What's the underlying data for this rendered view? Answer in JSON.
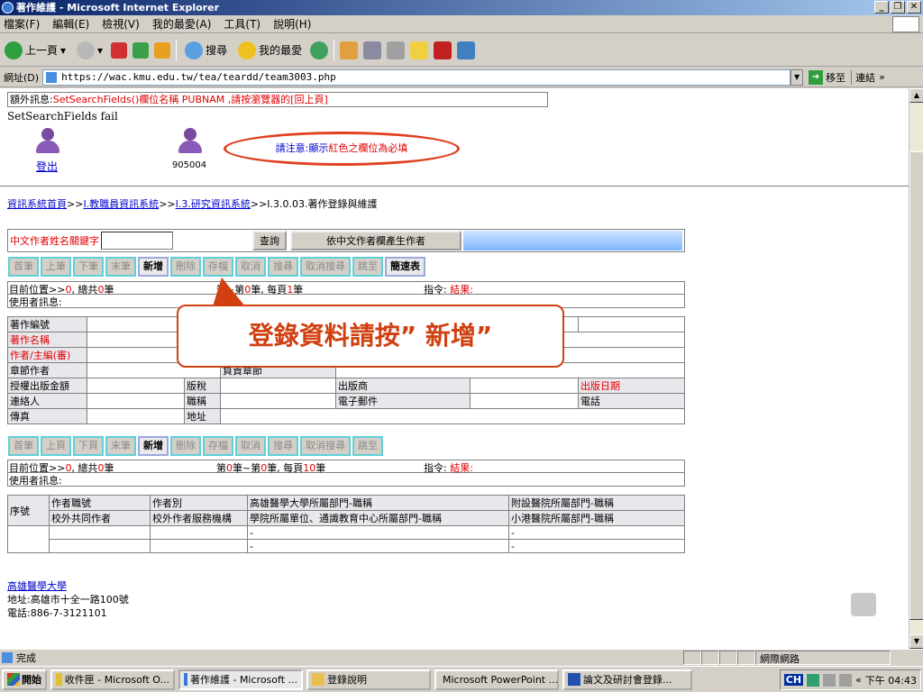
{
  "window": {
    "title": "著作維護 - Microsoft Internet Explorer"
  },
  "menu": [
    "檔案(F)",
    "編輯(E)",
    "檢視(V)",
    "我的最愛(A)",
    "工具(T)",
    "說明(H)"
  ],
  "toolbar": {
    "back": "上一頁",
    "search": "搜尋",
    "favorites": "我的最愛"
  },
  "address": {
    "label": "網址(D)",
    "url": "https://wac.kmu.edu.tw/tea/teardd/team3003.php",
    "go": "移至",
    "links": "連結"
  },
  "page": {
    "message_prefix": "額外訊息:",
    "message": "SetSearchFields()欄位名稱 PUBNAM ,請按瀏覽器的[回上頁]",
    "fail": "SetSearchFields fail",
    "logout": "登出",
    "user_id": "905004",
    "notice_a": "請注意:顯示",
    "notice_b": "紅色之欄位為必填",
    "breadcrumb": {
      "a": "資訊系統首頁",
      "b": "I.教職員資訊系統",
      "c": "I.3.研究資訊系統",
      "d": ">>I.3.0.03.著作登錄與維護"
    },
    "search_label": "中文作者姓名關鍵字",
    "query_btn": "查詢",
    "gen_author_btn": "依中文作者欄產生作者",
    "nav": [
      "首筆",
      "上筆",
      "下筆",
      "末筆",
      "新增",
      "刪除",
      "存檔",
      "取消",
      "搜尋",
      "取消搜尋",
      "跳至",
      "簡速表"
    ],
    "nav2": [
      "首筆",
      "上頁",
      "下頁",
      "末筆",
      "新增",
      "刪除",
      "存檔",
      "取消",
      "搜尋",
      "取消搜尋",
      "跳至"
    ],
    "pos1": {
      "a": "目前位置>>",
      "b": "0",
      "c": ", 總共",
      "d": "0",
      "e": "筆",
      "f": "筆~第",
      "g": "0",
      "h": "筆, 每頁",
      "i": "1",
      "j": "筆",
      "k": "指令:",
      "l": "結果:"
    },
    "pos2": {
      "a": "目前位置>>",
      "b": "0",
      "c": ", 總共",
      "d": "0",
      "e": "筆",
      "f": "第",
      "g": "0",
      "h": "筆~第",
      "i": "0",
      "j": "筆, 每頁",
      "k": "10",
      "l": "筆",
      "m": "指令:",
      "n": "結果:"
    },
    "user_msg": "使用者訊息:",
    "form": {
      "author_no": "著作編號",
      "title": "著作名稱",
      "author_editor": "作者/主編(審)",
      "chapter_author": "章節作者",
      "chapter_resp": "負責章節",
      "license": "授權出版金額",
      "tax": "版稅",
      "publisher": "出版商",
      "pub_date": "出版日期",
      "contact": "連絡人",
      "job": "職稱",
      "email": "電子郵件",
      "phone": "電話",
      "fax": "傳真",
      "address": "地址"
    },
    "list_head": {
      "seq": "序號",
      "job": "作者職號",
      "type": "作者別",
      "dept": "高雄醫學大學所屬部門-職稱",
      "hosp": "附設醫院所屬部門-職稱",
      "co_author": "校外共同作者",
      "service": "校外作者服務機構",
      "school": "學院所屬單位、通識教育中心所屬部門-職稱",
      "xiaogang": "小港醫院所屬部門-職稱"
    },
    "callout": "登錄資料請按” 新增”",
    "footer": {
      "name": "高雄醫學大學",
      "addr": "地址:高雄市十全一路100號",
      "tel": "電話:886-7-3121101"
    }
  },
  "status": {
    "text": "完成",
    "zone": "網際網路"
  },
  "taskbar": {
    "start": "開始",
    "tasks": [
      "收件匣 - Microsoft O...",
      "著作維護 - Microsoft ...",
      "登錄說明",
      "Microsoft PowerPoint ...",
      "論文及研討會登錄..."
    ],
    "ime": "CH",
    "clock": "下午 04:43"
  }
}
